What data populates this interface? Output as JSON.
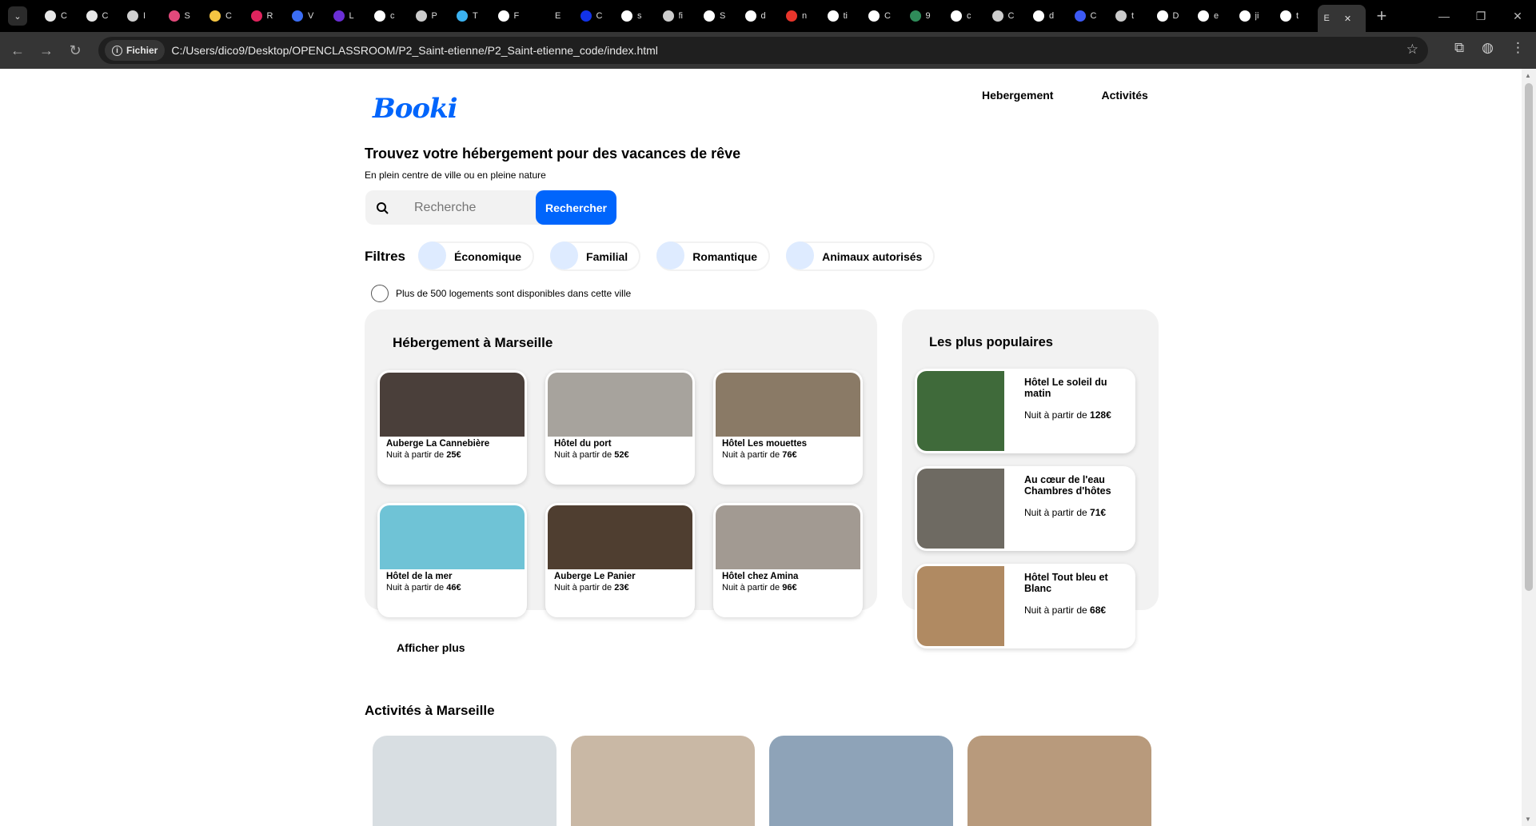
{
  "browser": {
    "tabs": [
      {
        "label": "C",
        "icon": "triangle-icon",
        "color": "#e8e8e8"
      },
      {
        "label": "C",
        "icon": "triangle-icon",
        "color": "#e8e8e8"
      },
      {
        "label": "I",
        "icon": "openai-icon",
        "color": "#cfcfcf"
      },
      {
        "label": "S",
        "icon": "colorful-icon",
        "color": "#e2497b"
      },
      {
        "label": "C",
        "icon": "smiley-icon",
        "color": "#f5c542"
      },
      {
        "label": "R",
        "icon": "gear-icon",
        "color": "#e0245e"
      },
      {
        "label": "V",
        "icon": "doc-icon",
        "color": "#3b6ef5"
      },
      {
        "label": "L",
        "icon": "hexagon-icon",
        "color": "#6b2fd6"
      },
      {
        "label": "c",
        "icon": "google-icon",
        "color": "#ffffff"
      },
      {
        "label": "P",
        "icon": "square-icon",
        "color": "#cccccc"
      },
      {
        "label": "T",
        "icon": "wave-icon",
        "color": "#3bb2f0"
      },
      {
        "label": "F",
        "icon": "vd-icon",
        "color": "#ffffff"
      },
      {
        "label": "E",
        "icon": "none",
        "color": "#000000"
      },
      {
        "label": "C",
        "icon": "circle-icon",
        "color": "#1233e8"
      },
      {
        "label": "s",
        "icon": "google-icon",
        "color": "#ffffff"
      },
      {
        "label": "fi",
        "icon": "m-icon",
        "color": "#cccccc"
      },
      {
        "label": "S",
        "icon": "github-icon",
        "color": "#ffffff"
      },
      {
        "label": "d",
        "icon": "google-icon",
        "color": "#ffffff"
      },
      {
        "label": "n",
        "icon": "h-icon",
        "color": "#e8352b"
      },
      {
        "label": "ti",
        "icon": "google-icon",
        "color": "#ffffff"
      },
      {
        "label": "C",
        "icon": "google-icon",
        "color": "#ffffff"
      },
      {
        "label": "9",
        "icon": "k-icon",
        "color": "#2f8c5a"
      },
      {
        "label": "c",
        "icon": "google-icon",
        "color": "#ffffff"
      },
      {
        "label": "C",
        "icon": "n-icon",
        "color": "#cccccc"
      },
      {
        "label": "d",
        "icon": "google-icon",
        "color": "#ffffff"
      },
      {
        "label": "C",
        "icon": "hexagon-icon",
        "color": "#3d5af5"
      },
      {
        "label": "t",
        "icon": "m-icon",
        "color": "#cccccc"
      },
      {
        "label": "D",
        "icon": "info-icon",
        "color": "#ffffff"
      },
      {
        "label": "e",
        "icon": "google-icon",
        "color": "#ffffff"
      },
      {
        "label": "ji",
        "icon": "github-icon",
        "color": "#ffffff"
      },
      {
        "label": "t",
        "icon": "google-icon",
        "color": "#ffffff"
      }
    ],
    "active_tab": {
      "label": "E",
      "close": "✕"
    },
    "new_tab": "+",
    "chip_label": "Fichier",
    "url": "C:/Users/dico9/Desktop/OPENCLASSROOM/P2_Saint-etienne/P2_Saint-etienne_code/index.html"
  },
  "site": {
    "logo": "Booki",
    "nav": [
      "Hebergement",
      "Activités"
    ],
    "hero_title": "Trouvez votre hébergement pour des vacances de rêve",
    "hero_subtitle": "En plein centre de ville ou en pleine nature",
    "search_placeholder": "Recherche",
    "search_button": "Rechercher",
    "filters_label": "Filtres",
    "filters": [
      "Économique",
      "Familial",
      "Romantique",
      "Animaux autorisés"
    ],
    "info_text": "Plus de 500 logements sont disponibles dans cette ville",
    "hebergements_title": "Hébergement à Marseille",
    "hebergements": [
      {
        "name": "Auberge La Cannebière",
        "price_prefix": "Nuit à partir de",
        "price": "25€",
        "img": "#4a3f3a"
      },
      {
        "name": "Hôtel du port",
        "price_prefix": "Nuit à partir de",
        "price": "52€",
        "img": "#a7a39d"
      },
      {
        "name": "Hôtel Les mouettes",
        "price_prefix": "Nuit à partir de",
        "price": "76€",
        "img": "#8a7a66"
      },
      {
        "name": "Hôtel de la mer",
        "price_prefix": "Nuit à partir de",
        "price": "46€",
        "img": "#6fc3d6"
      },
      {
        "name": "Auberge Le Panier",
        "price_prefix": "Nuit à partir de",
        "price": "23€",
        "img": "#4f3e30"
      },
      {
        "name": "Hôtel chez Amina",
        "price_prefix": "Nuit à partir de",
        "price": "96€",
        "img": "#a29a92"
      }
    ],
    "more_label": "Afficher plus",
    "populaires_title": "Les plus populaires",
    "populaires": [
      {
        "name": "Hôtel Le soleil du matin",
        "price_prefix": "Nuit à partir de",
        "price": "128€",
        "img": "#3f6a3a"
      },
      {
        "name": "Au cœur de l'eau Chambres d'hôtes",
        "price_prefix": "Nuit à partir de",
        "price": "71€",
        "img": "#6e6a62"
      },
      {
        "name": "Hôtel Tout bleu et Blanc",
        "price_prefix": "Nuit à partir de",
        "price": "68€",
        "img": "#b08a62"
      }
    ],
    "activites_title": "Activités à Marseille",
    "activites_colors": [
      "#d8dee2",
      "#c9b8a5",
      "#8ea3b8",
      "#b89a7c"
    ]
  }
}
